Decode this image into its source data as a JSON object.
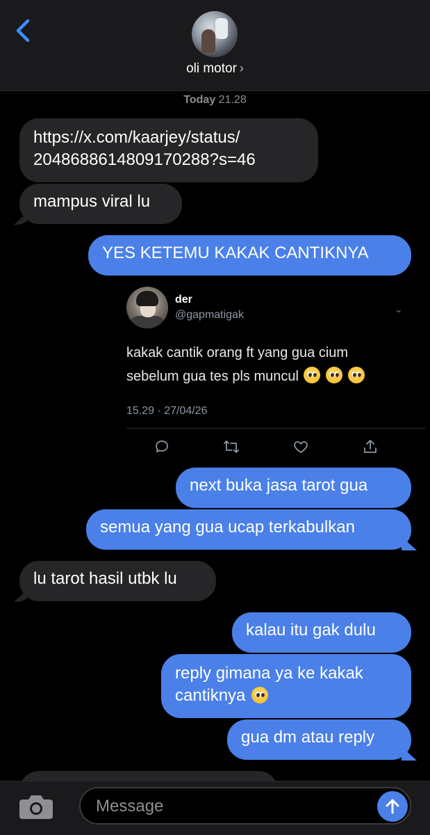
{
  "header": {
    "back_icon": "chevron-left-icon",
    "contact_name": "oli motor",
    "contact_chevron": "›"
  },
  "timestamp": {
    "day": "Today",
    "time": "21.28"
  },
  "messages": [
    {
      "type": "received",
      "text_line1": "https://x.com/kaarjey/status/",
      "text_line2": "2048688614809170288?s=46"
    },
    {
      "type": "received",
      "text": "mampus viral lu"
    },
    {
      "type": "sent",
      "text": "YES KETEMU KAKAK CANTIKNYA"
    },
    {
      "type": "sent",
      "text": "next buka jasa tarot gua"
    },
    {
      "type": "sent",
      "text": "semua yang gua ucap terkabulkan"
    },
    {
      "type": "received",
      "text": "lu tarot hasil utbk lu"
    },
    {
      "type": "sent",
      "text": "kalau itu gak dulu"
    },
    {
      "type": "sent",
      "text_line1": "reply gimana ya ke kakak",
      "text_line2": "cantiknya",
      "emoji": "pleading-face"
    },
    {
      "type": "sent",
      "text": "gua dm atau reply"
    }
  ],
  "tweet": {
    "name": "der",
    "handle": "@gapmatigak",
    "text_line1": "kakak cantik orang ft yang gua cium",
    "text_line2": "sebelum gua tes pls muncul",
    "emojis": [
      "pleading-face",
      "pleading-face",
      "pleading-face"
    ],
    "meta": "15.29 · 27/04/26",
    "caret": "⌄",
    "actions": [
      "reply-icon",
      "retweet-icon",
      "like-icon",
      "share-icon"
    ]
  },
  "composer": {
    "placeholder": "Message",
    "camera_icon": "camera-icon",
    "send_icon": "send-arrow-icon"
  },
  "colors": {
    "sent_bubble": "#4a80e8",
    "received_bubble": "#262628",
    "accent": "#3478f6"
  }
}
